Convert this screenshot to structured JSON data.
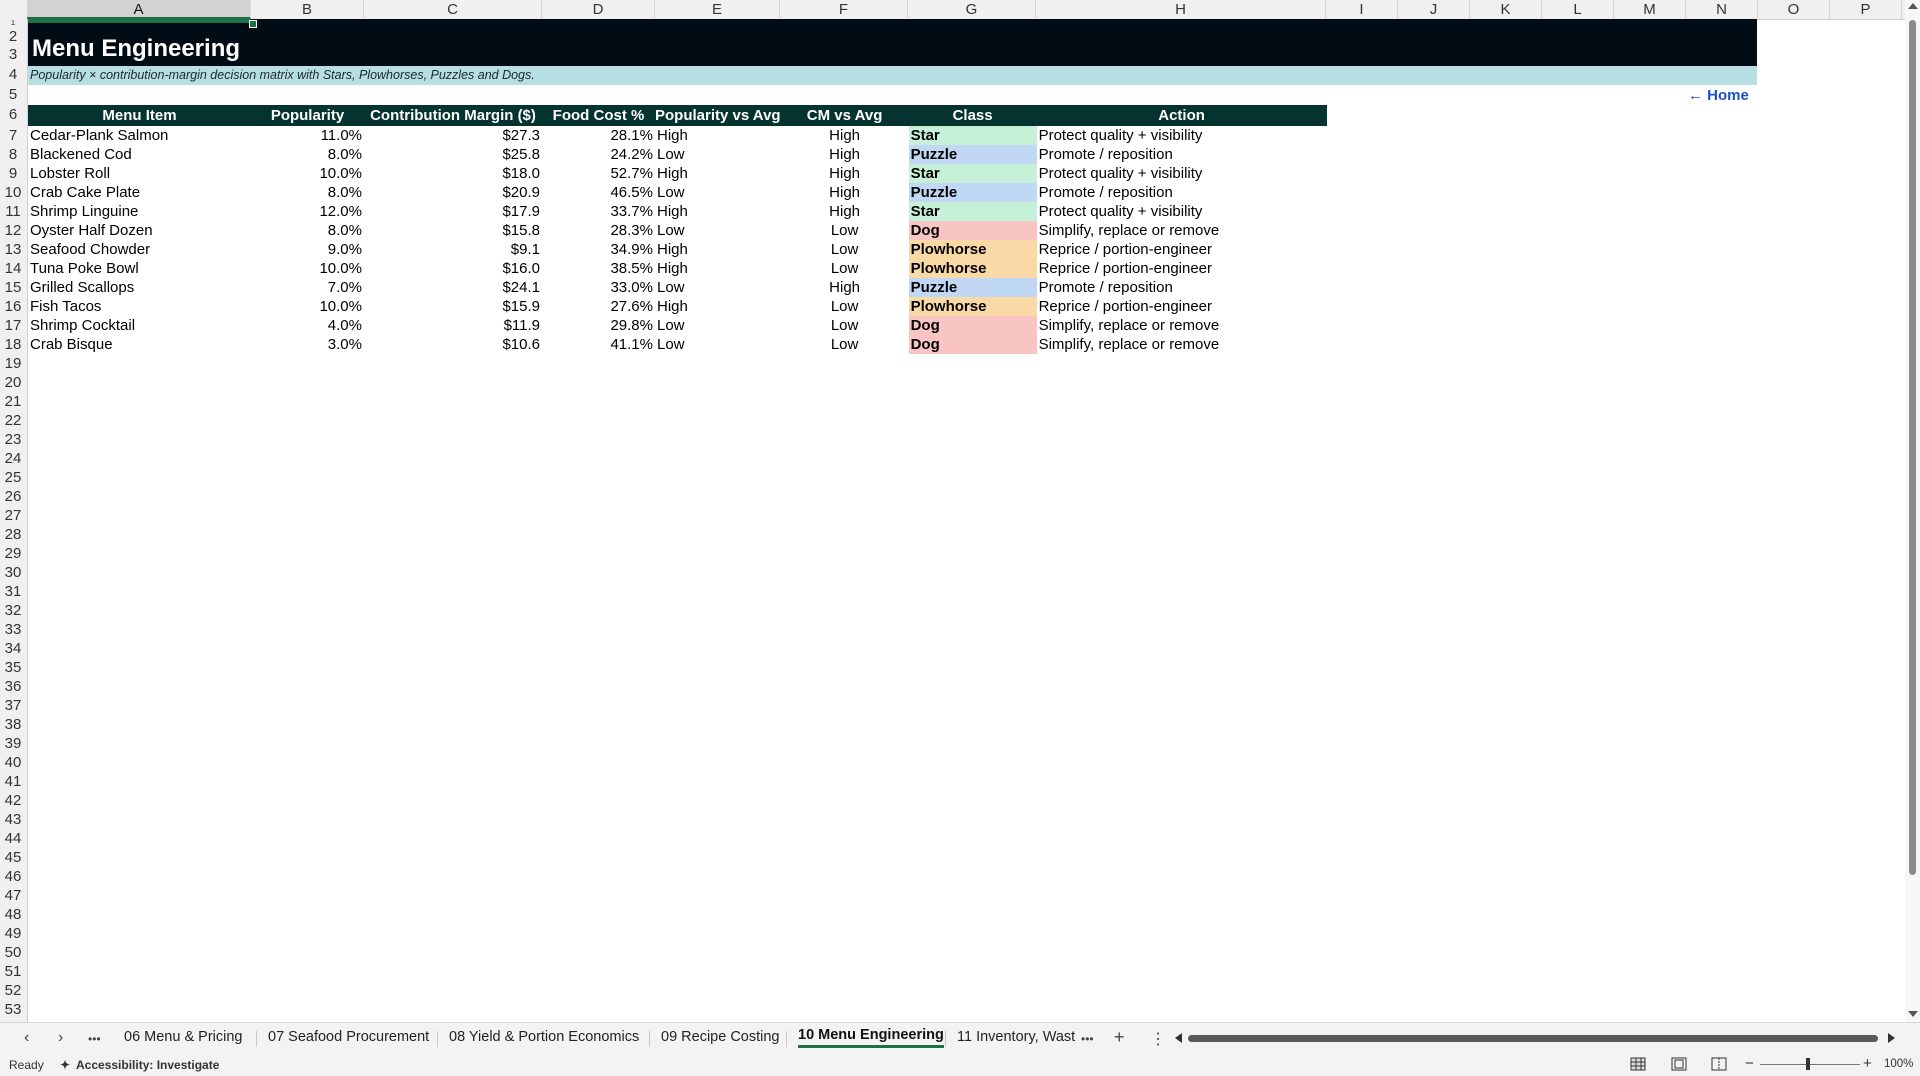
{
  "columns": [
    "A",
    "B",
    "C",
    "D",
    "E",
    "F",
    "G",
    "H",
    "I",
    "J",
    "K",
    "L",
    "M",
    "N",
    "O",
    "P"
  ],
  "rows": [
    "1",
    "2",
    "3",
    "4",
    "5",
    "6",
    "7",
    "8",
    "9",
    "10",
    "11",
    "12",
    "13",
    "14",
    "15",
    "16",
    "17",
    "18",
    "19",
    "20",
    "21",
    "22",
    "23",
    "24",
    "25",
    "26",
    "27",
    "28",
    "29",
    "30",
    "31",
    "32",
    "33",
    "34",
    "35",
    "36",
    "37",
    "38",
    "39",
    "40",
    "41",
    "42",
    "43",
    "44",
    "45",
    "46",
    "47",
    "48",
    "49",
    "50",
    "51",
    "52",
    "53"
  ],
  "sheet": {
    "title": "Menu Engineering",
    "subtitle": "Popularity × contribution-margin decision matrix with Stars, Plowhorses, Puzzles and Dogs.",
    "home_link": "← Home"
  },
  "table": {
    "headers": [
      "Menu Item",
      "Popularity",
      "Contribution Margin ($)",
      "Food Cost %",
      "Popularity vs Avg",
      "CM vs Avg",
      "Class",
      "Action"
    ],
    "rows": [
      {
        "item": "Cedar-Plank Salmon",
        "popularity": "11.0%",
        "cm": "$27.3",
        "food_cost": "28.1%",
        "pop_vs_avg": "High",
        "cm_vs_avg": "High",
        "class": "Star",
        "action": "Protect quality + visibility"
      },
      {
        "item": "Blackened Cod",
        "popularity": "8.0%",
        "cm": "$25.8",
        "food_cost": "24.2%",
        "pop_vs_avg": "Low",
        "cm_vs_avg": "High",
        "class": "Puzzle",
        "action": "Promote / reposition"
      },
      {
        "item": "Lobster Roll",
        "popularity": "10.0%",
        "cm": "$18.0",
        "food_cost": "52.7%",
        "pop_vs_avg": "High",
        "cm_vs_avg": "High",
        "class": "Star",
        "action": "Protect quality + visibility"
      },
      {
        "item": "Crab Cake Plate",
        "popularity": "8.0%",
        "cm": "$20.9",
        "food_cost": "46.5%",
        "pop_vs_avg": "Low",
        "cm_vs_avg": "High",
        "class": "Puzzle",
        "action": "Promote / reposition"
      },
      {
        "item": "Shrimp Linguine",
        "popularity": "12.0%",
        "cm": "$17.9",
        "food_cost": "33.7%",
        "pop_vs_avg": "High",
        "cm_vs_avg": "High",
        "class": "Star",
        "action": "Protect quality + visibility"
      },
      {
        "item": "Oyster Half Dozen",
        "popularity": "8.0%",
        "cm": "$15.8",
        "food_cost": "28.3%",
        "pop_vs_avg": "Low",
        "cm_vs_avg": "Low",
        "class": "Dog",
        "action": "Simplify, replace or remove"
      },
      {
        "item": "Seafood Chowder",
        "popularity": "9.0%",
        "cm": "$9.1",
        "food_cost": "34.9%",
        "pop_vs_avg": "High",
        "cm_vs_avg": "Low",
        "class": "Plowhorse",
        "action": "Reprice / portion-engineer"
      },
      {
        "item": "Tuna Poke Bowl",
        "popularity": "10.0%",
        "cm": "$16.0",
        "food_cost": "38.5%",
        "pop_vs_avg": "High",
        "cm_vs_avg": "Low",
        "class": "Plowhorse",
        "action": "Reprice / portion-engineer"
      },
      {
        "item": "Grilled Scallops",
        "popularity": "7.0%",
        "cm": "$24.1",
        "food_cost": "33.0%",
        "pop_vs_avg": "Low",
        "cm_vs_avg": "High",
        "class": "Puzzle",
        "action": "Promote / reposition"
      },
      {
        "item": "Fish Tacos",
        "popularity": "10.0%",
        "cm": "$15.9",
        "food_cost": "27.6%",
        "pop_vs_avg": "High",
        "cm_vs_avg": "Low",
        "class": "Plowhorse",
        "action": "Reprice / portion-engineer"
      },
      {
        "item": "Shrimp Cocktail",
        "popularity": "4.0%",
        "cm": "$11.9",
        "food_cost": "29.8%",
        "pop_vs_avg": "Low",
        "cm_vs_avg": "Low",
        "class": "Dog",
        "action": "Simplify, replace or remove"
      },
      {
        "item": "Crab Bisque",
        "popularity": "3.0%",
        "cm": "$10.6",
        "food_cost": "41.1%",
        "pop_vs_avg": "Low",
        "cm_vs_avg": "Low",
        "class": "Dog",
        "action": "Simplify, replace or remove"
      }
    ]
  },
  "class_colors": {
    "Star": "#c6f0d8",
    "Puzzle": "#c0d8f4",
    "Dog": "#f8c4c4",
    "Plowhorse": "#f9d9a6"
  },
  "colors": {
    "banner": "#020c14",
    "subtitle_band": "#b7dee2",
    "table_header": "#05332f",
    "link": "#1f4fc1",
    "selection": "#1e7145"
  },
  "tabs": {
    "prev_icon": "chevron-left-icon",
    "next_icon": "chevron-right-icon",
    "more_left": "•••",
    "items": [
      "06 Menu & Pricing",
      "07 Seafood Procurement",
      "08 Yield & Portion Economics",
      "09 Recipe Costing",
      "10 Menu Engineering",
      "11 Inventory, Wast"
    ],
    "active": "10 Menu Engineering",
    "more_right": "•••",
    "add": "+",
    "options": "⋮"
  },
  "status": {
    "ready": "Ready",
    "accessibility": "Accessibility: Investigate",
    "zoom": "100%",
    "zoom_minus": "−",
    "zoom_plus": "+"
  }
}
